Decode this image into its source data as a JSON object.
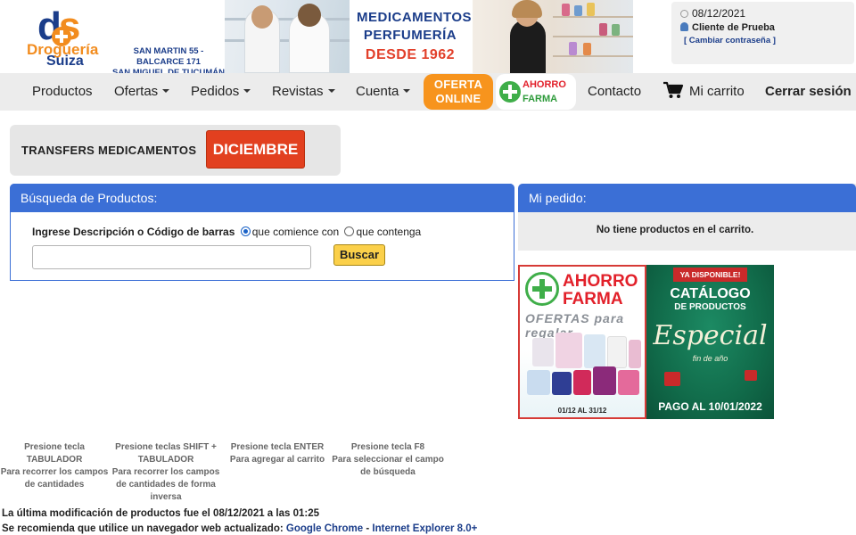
{
  "header": {
    "logo": {
      "mark": "ds",
      "word1": "Droguería",
      "word2": "Suiza"
    },
    "address": [
      "SAN MARTIN 55 - BALCARCE 171",
      "SAN MIGUEL DE TUCUMÁN"
    ],
    "tagline": {
      "line1": "MEDICAMENTOS",
      "line2": "PERFUMERÍA",
      "line3": "DESDE 1962"
    },
    "user_box": {
      "date": "08/12/2021",
      "user": "Cliente de Prueba",
      "change_password": "[ Cambiar contraseña ]"
    }
  },
  "nav": {
    "items": [
      {
        "label": "Productos",
        "dropdown": false
      },
      {
        "label": "Ofertas",
        "dropdown": true
      },
      {
        "label": "Pedidos",
        "dropdown": true
      },
      {
        "label": "Revistas",
        "dropdown": true
      },
      {
        "label": "Cuenta",
        "dropdown": true
      }
    ],
    "oferta_online": [
      "OFERTA",
      "ONLINE"
    ],
    "ahorro_farma": [
      "AHORRO",
      "FARMA"
    ],
    "contacto": "Contacto",
    "cart": "Mi carrito",
    "logout": "Cerrar sesión"
  },
  "transfers": {
    "label": "TRANSFERS MEDICAMENTOS",
    "button": "DICIEMBRE"
  },
  "search": {
    "title": "Búsqueda de Productos:",
    "field_label": "Ingrese Descripción o Código de barras",
    "option_starts": "que comience con",
    "option_contains": "que contenga",
    "selected_option": "que comience con",
    "input_value": "",
    "button": "Buscar"
  },
  "order": {
    "title": "Mi pedido:",
    "empty_message": "No tiene productos en el carrito."
  },
  "banner": {
    "left": {
      "title1": "AHORRO",
      "title2": "FARMA",
      "subtitle": "OFERTAS para regalar",
      "dates": "01/12 AL 31/12"
    },
    "right": {
      "badge": "YA DISPONIBLE!",
      "title1": "CATÁLOGO",
      "title2": "DE PRODUCTOS",
      "script": "Especial",
      "script_sub": "fin de año",
      "payment": "PAGO AL 10/01/2022"
    }
  },
  "shortcuts": [
    {
      "title": "Presione tecla TABULADOR",
      "desc": "Para recorrer los campos de cantidades"
    },
    {
      "title": "Presione teclas SHIFT + TABULADOR",
      "desc": "Para recorrer los campos de cantidades de forma inversa"
    },
    {
      "title": "Presione tecla ENTER",
      "desc": "Para agregar al carrito"
    },
    {
      "title": "Presione tecla F8",
      "desc": "Para seleccionar el campo de búsqueda"
    }
  ],
  "footer": {
    "last_update": "La última modificación de productos fue el 08/12/2021 a las 01:25",
    "browser_prefix": "Se recomienda que utilice un navegador web actualizado:",
    "browser_chrome": "Google Chrome",
    "browser_sep": "-",
    "browser_ie": "Internet Explorer 8.0+"
  },
  "colors": {
    "brand_blue": "#1b3d8a",
    "brand_orange": "#f28c1e",
    "panel_blue": "#3b6fd6",
    "diciembre_red": "#e2401f",
    "buscar_yellow": "#fbd04a"
  }
}
